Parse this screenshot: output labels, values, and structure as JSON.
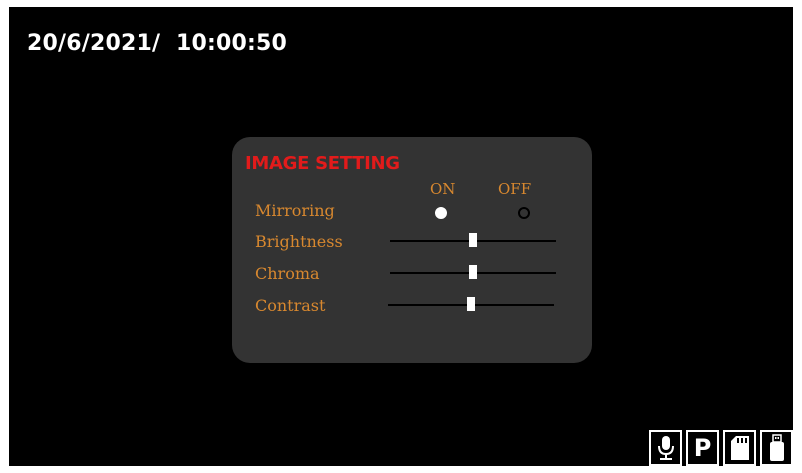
{
  "header": {
    "datetime": "20/6/2021/  10:00:50"
  },
  "image_setting": {
    "title": "IMAGE SETTING",
    "columns": {
      "on": "ON",
      "off": "OFF"
    },
    "mirroring": {
      "label": "Mirroring",
      "selected": "ON"
    },
    "sliders": [
      {
        "label": "Brightness",
        "value": 0.5
      },
      {
        "label": "Chroma",
        "value": 0.5
      },
      {
        "label": "Contrast",
        "value": 0.5
      }
    ]
  },
  "status_icons": [
    "microphone-icon",
    "parking-p-icon",
    "sd-card-icon",
    "usb-drive-icon"
  ],
  "colors": {
    "background": "#000000",
    "panel": "#333333",
    "title": "#e21b1b",
    "label": "#d8882f",
    "foreground": "#ffffff"
  }
}
